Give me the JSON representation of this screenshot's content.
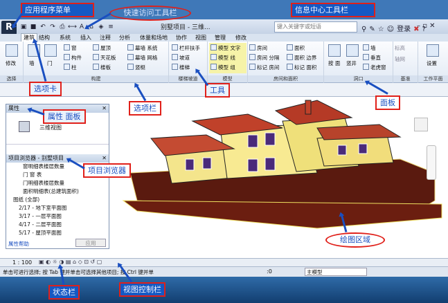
{
  "callouts": {
    "app_menu": "应用程序菜单",
    "quick_access": "快速访问工具栏",
    "info_center": "信息中心工具栏",
    "tab": "选项卡",
    "tools": "工具",
    "options_bar": "选项栏",
    "ribbon_panel": "面板",
    "properties_panel": "属性 面板",
    "project_browser": "项目浏览器",
    "drawing_area": "绘图区域",
    "status_bar": "状态栏",
    "view_control_bar": "视图控制栏"
  },
  "app": {
    "title": "别墅项目 - 三维...",
    "search_placeholder": "键入关键字或短语",
    "login": "登录"
  },
  "tabs": [
    "建筑",
    "结构",
    "系统",
    "插入",
    "注释",
    "分析",
    "体量和场地",
    "协作",
    "视图",
    "管理",
    "修改"
  ],
  "ribbon": {
    "select": {
      "modify": "修改",
      "label": "选择"
    },
    "build": {
      "items": [
        "墙",
        "门",
        "窗",
        "构件",
        "柱",
        "屋顶",
        "天花板",
        "楼板",
        "幕墙 系统",
        "幕墙 网格",
        "竖梃"
      ],
      "label": "构建"
    },
    "circulation": {
      "items": [
        "栏杆扶手",
        "坡道",
        "楼梯"
      ],
      "label": "楼梯坡道"
    },
    "model": {
      "items": [
        "模型 文字",
        "模型 线",
        "模型 组"
      ],
      "label": "模型"
    },
    "room_area": {
      "items": [
        "房间",
        "房间 分隔",
        "标记 房间",
        "面积",
        "面积 边界",
        "标记 面积"
      ],
      "label": "房间和面积"
    },
    "opening": {
      "items": [
        "按 面",
        "竖井",
        "墙",
        "垂直",
        "老虎窗"
      ],
      "label": "洞口"
    },
    "datum": {
      "items": [
        "标高",
        "轴网"
      ],
      "label": "基准"
    },
    "workplane": {
      "items": [
        "设置"
      ],
      "label": "工作平面"
    }
  },
  "properties": {
    "title": "属性",
    "type": "三维视图",
    "help": "属性帮助",
    "apply": "应用"
  },
  "browser": {
    "title": "项目浏览器 - 别墅项目",
    "items": [
      "窗明细表楼层数量",
      "门 窗 表",
      "门明细表楼层数量",
      "面积明细表(总建筑面积)",
      "图纸 (全部)",
      "2/17 - 地下室平面图",
      "3/17 - 一层平面图",
      "4/17 - 二层平面图",
      "5/17 - 屋顶平面图"
    ]
  },
  "statusbar": {
    "scale": "1 : 100",
    "hint": "单击可进行选择; 按 Tab 键并单击可选择其他项目; 按 Ctrl 键并单",
    "zero": ":0",
    "model": "主模型"
  }
}
